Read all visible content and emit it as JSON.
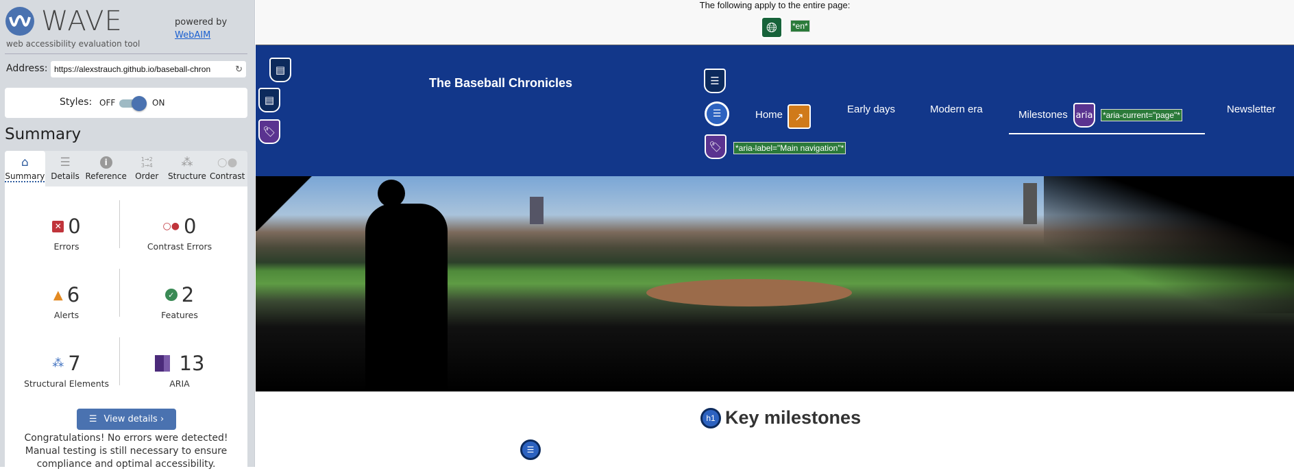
{
  "wave": {
    "title": "WAVE",
    "subtitle": "web accessibility evaluation tool",
    "powered_by": "powered by",
    "webaim": "WebAIM",
    "address_label": "Address:",
    "address_value": "https://alexstrauch.github.io/baseball-chron",
    "styles_label": "Styles:",
    "styles_off": "OFF",
    "styles_on": "ON",
    "styles_enabled": true,
    "summary_heading": "Summary",
    "tabs": [
      {
        "label": "Summary",
        "icon": "home-icon",
        "active": true
      },
      {
        "label": "Details",
        "icon": "list-icon"
      },
      {
        "label": "Reference",
        "icon": "info-icon"
      },
      {
        "label": "Order",
        "icon": "order-icon"
      },
      {
        "label": "Structure",
        "icon": "structure-icon"
      },
      {
        "label": "Contrast",
        "icon": "contrast-icon"
      }
    ],
    "stats": [
      {
        "label": "Errors",
        "value": "0",
        "color": "#c0343b"
      },
      {
        "label": "Contrast Errors",
        "value": "0",
        "color": "#c0343b"
      },
      {
        "label": "Alerts",
        "value": "6",
        "color": "#e38a22"
      },
      {
        "label": "Features",
        "value": "2",
        "color": "#3a8a55"
      },
      {
        "label": "Structural Elements",
        "value": "7",
        "color": "#3d6fbf"
      },
      {
        "label": "ARIA",
        "value": "13",
        "color": "#4b2a7a"
      }
    ],
    "view_details": "View details ›",
    "congrats": "Congratulations! No errors were detected! Manual testing is still necessary to ensure compliance and optimal accessibility."
  },
  "page": {
    "apply_text": "The following apply to the entire page:",
    "lang_tag": "*en*",
    "site_title": "The Baseball Chronicles",
    "nav": [
      "Home",
      "Early days",
      "Modern era",
      "Milestones",
      "Newsletter"
    ],
    "aria_current_tag": "*aria-current=\"page\"*",
    "aria_label_tag": "*aria-label=\"Main navigation\"*",
    "aria_icon_text": "aria",
    "h1_badge": "h1",
    "heading": "Key milestones"
  }
}
